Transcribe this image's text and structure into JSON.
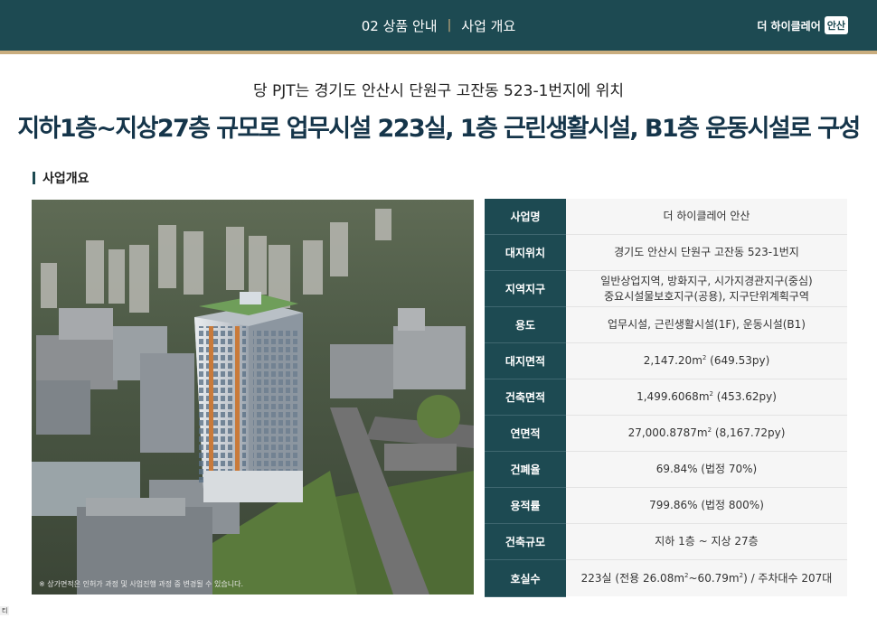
{
  "header": {
    "section": "02 상품 안내",
    "separator": "|",
    "page": "사업 개요",
    "brand": "더 하이클레어",
    "brand_badge": "안산"
  },
  "subtitle": "당 PJT는 경기도 안산시 단원구 고잔동 523-1번지에 위치",
  "headline": "지하1층~지상27층 규모로 업무시설 223실, 1층 근린생활시설, B1층 운동시설로 구성",
  "section_title": "사업개요",
  "photo": {
    "note": "※ 상가면적은 인허가 과정 및 사업진행 과정 중 변경될 수 있습니다."
  },
  "table": {
    "rows": [
      {
        "label": "사업명",
        "value": "더 하이클레어 안산"
      },
      {
        "label": "대지위치",
        "value": "경기도 안산시 단원구 고잔동 523-1번지"
      },
      {
        "label": "지역지구",
        "value_line1": "일반상업지역, 방화지구, 시가지경관지구(중심)",
        "value_line2": "중요시설물보호지구(공용), 지구단위계획구역"
      },
      {
        "label": "용도",
        "value": "업무시설, 근린생활시설(1F), 운동시설(B1)"
      },
      {
        "label": "대지면적",
        "value_a": "2,147.20m",
        "sup": "2",
        "value_b": " (649.53py)"
      },
      {
        "label": "건축면적",
        "value_a": "1,499.6068m",
        "sup": "2",
        "value_b": " (453.62py)"
      },
      {
        "label": "연면적",
        "value_a": "27,000.8787m",
        "sup": "2",
        "value_b": " (8,167.72py)"
      },
      {
        "label": "건폐율",
        "value": "69.84% (법정 70%)"
      },
      {
        "label": "용적률",
        "value": "799.86% (법정 800%)"
      },
      {
        "label": "건축규모",
        "value": "지하 1층 ~ 지상 27층"
      },
      {
        "label": "호실수",
        "value_a": "223실 (전용 26.08m",
        "sup1": "2",
        "value_b": "~60.79m",
        "sup2": "2",
        "value_c": ") / 주차대수 207대"
      }
    ]
  },
  "corner_label": "티"
}
